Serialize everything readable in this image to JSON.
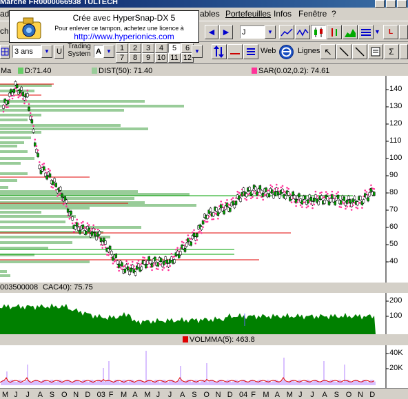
{
  "window": {
    "title": "Marche    FR0000066938  TULTECH"
  },
  "menu": {
    "items": [
      "ables",
      "Portefeuilles",
      "Infos",
      "Fenêtre",
      "?"
    ]
  },
  "stamp": {
    "line1": "Crée avec HyperSnap-DX 5",
    "line2": "Pour enlever ce tampon, achetez une licence à",
    "line3": "http://www.hyperionics.com"
  },
  "toolbar1": {
    "left_label": "che",
    "period_value": "J"
  },
  "toolbar2": {
    "duration_value": "3 ans",
    "u_label": "U",
    "trading_system_label": "Trading System",
    "a_label": "A",
    "numbers_top": [
      "1",
      "2",
      "3",
      "4",
      "5",
      "6"
    ],
    "numbers_bottom": [
      "7",
      "8",
      "9",
      "10",
      "11",
      "12"
    ],
    "selected_number": "5",
    "web_label": "Web",
    "lignes_label": "Lignes"
  },
  "colors": {
    "price_box": "#99cc99",
    "sar": "#ff3399",
    "accent_blue": "#0000cc",
    "volume_green": "#008000"
  },
  "panel_price": {
    "label_ma": "Ma",
    "label_d": "D:71.40",
    "label_dist": "DIST(50): 71.40",
    "label_sar": "SAR(0.02,0.2): 74.61",
    "y_ticks": [
      "140",
      "130",
      "120",
      "110",
      "100",
      "90",
      "80",
      "70",
      "60",
      "50",
      "40"
    ]
  },
  "panel_volume": {
    "label_id": "003500008",
    "label_cac": "CAC40): 75.75",
    "y_ticks": [
      "200",
      "100"
    ]
  },
  "panel_volma": {
    "label_volma": "VOLMMA(5): 463.8",
    "y_ticks": [
      "40K",
      "20K"
    ]
  },
  "x_axis": {
    "labels": [
      "M",
      "J",
      "J",
      "A",
      "S",
      "O",
      "N",
      "D",
      "03",
      "F",
      "M",
      "A",
      "M",
      "J",
      "J",
      "A",
      "S",
      "O",
      "N",
      "D",
      "04",
      "F",
      "M",
      "A",
      "M",
      "J",
      "J",
      "A",
      "S",
      "O",
      "N",
      "D"
    ]
  },
  "chart_data": {
    "type": "line",
    "title": "",
    "x": [
      "2002-05",
      "2002-06",
      "2002-07",
      "2002-08",
      "2002-09",
      "2002-10",
      "2002-11",
      "2002-12",
      "2003-01",
      "2003-02",
      "2003-03",
      "2003-04",
      "2003-05",
      "2003-06",
      "2003-07",
      "2003-08",
      "2003-09",
      "2003-10",
      "2003-11",
      "2003-12",
      "2004-01",
      "2004-02",
      "2004-03",
      "2004-04",
      "2004-05",
      "2004-06",
      "2004-07",
      "2004-08",
      "2004-09",
      "2004-10",
      "2004-11",
      "2004-12"
    ],
    "ylim": [
      30,
      150
    ],
    "series": [
      {
        "values": [
          130,
          142,
          135,
          95,
          88,
          78,
          60,
          58,
          55,
          45,
          36,
          35,
          40,
          40,
          40,
          48,
          55,
          68,
          70,
          72,
          80,
          82,
          80,
          80,
          78,
          76,
          76,
          76,
          76,
          75,
          76,
          82
        ]
      }
    ]
  }
}
